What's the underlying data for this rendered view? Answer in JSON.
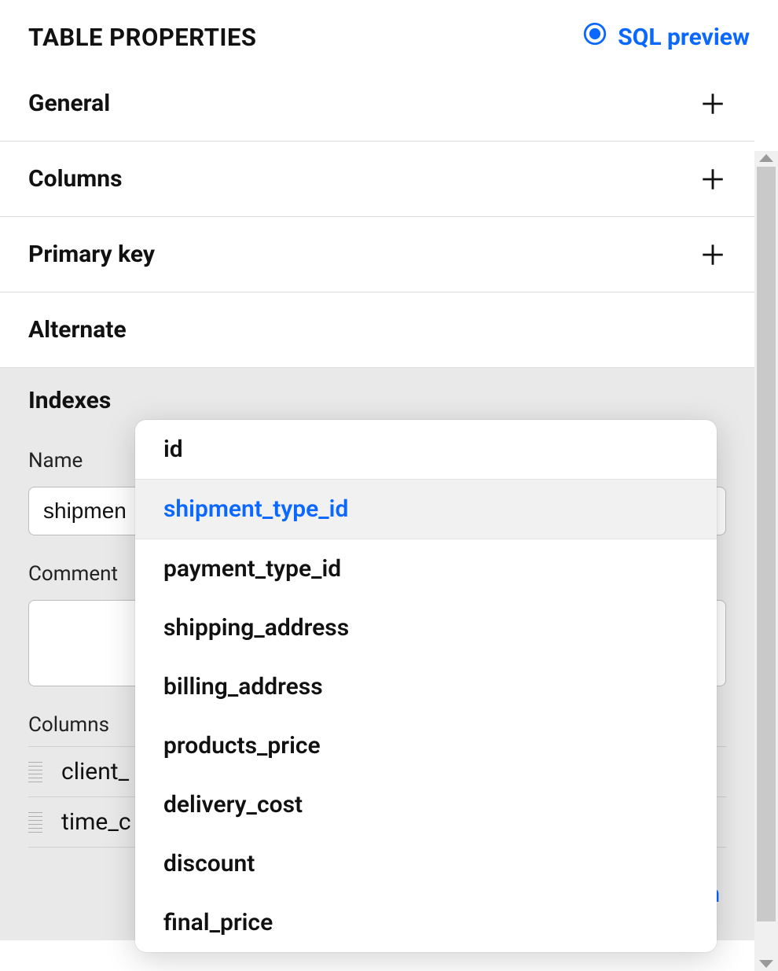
{
  "header": {
    "title": "TABLE PROPERTIES",
    "sql_preview_label": "SQL preview"
  },
  "sections": {
    "general": "General",
    "columns": "Columns",
    "primary_key": "Primary key",
    "alternate_keys": "Alternate"
  },
  "indexes": {
    "heading": "Indexes",
    "name_label": "Name",
    "name_value": "shipmen",
    "comment_label": "Comment",
    "comment_value": "",
    "columns_label": "Columns",
    "rows": [
      "client_",
      "time_c"
    ],
    "add_column_label": "Add column"
  },
  "dropdown": {
    "options": [
      "id",
      "shipment_type_id",
      "payment_type_id",
      "shipping_address",
      "billing_address",
      "products_price",
      "delivery_cost",
      "discount",
      "final_price"
    ],
    "selected_index": 1
  }
}
